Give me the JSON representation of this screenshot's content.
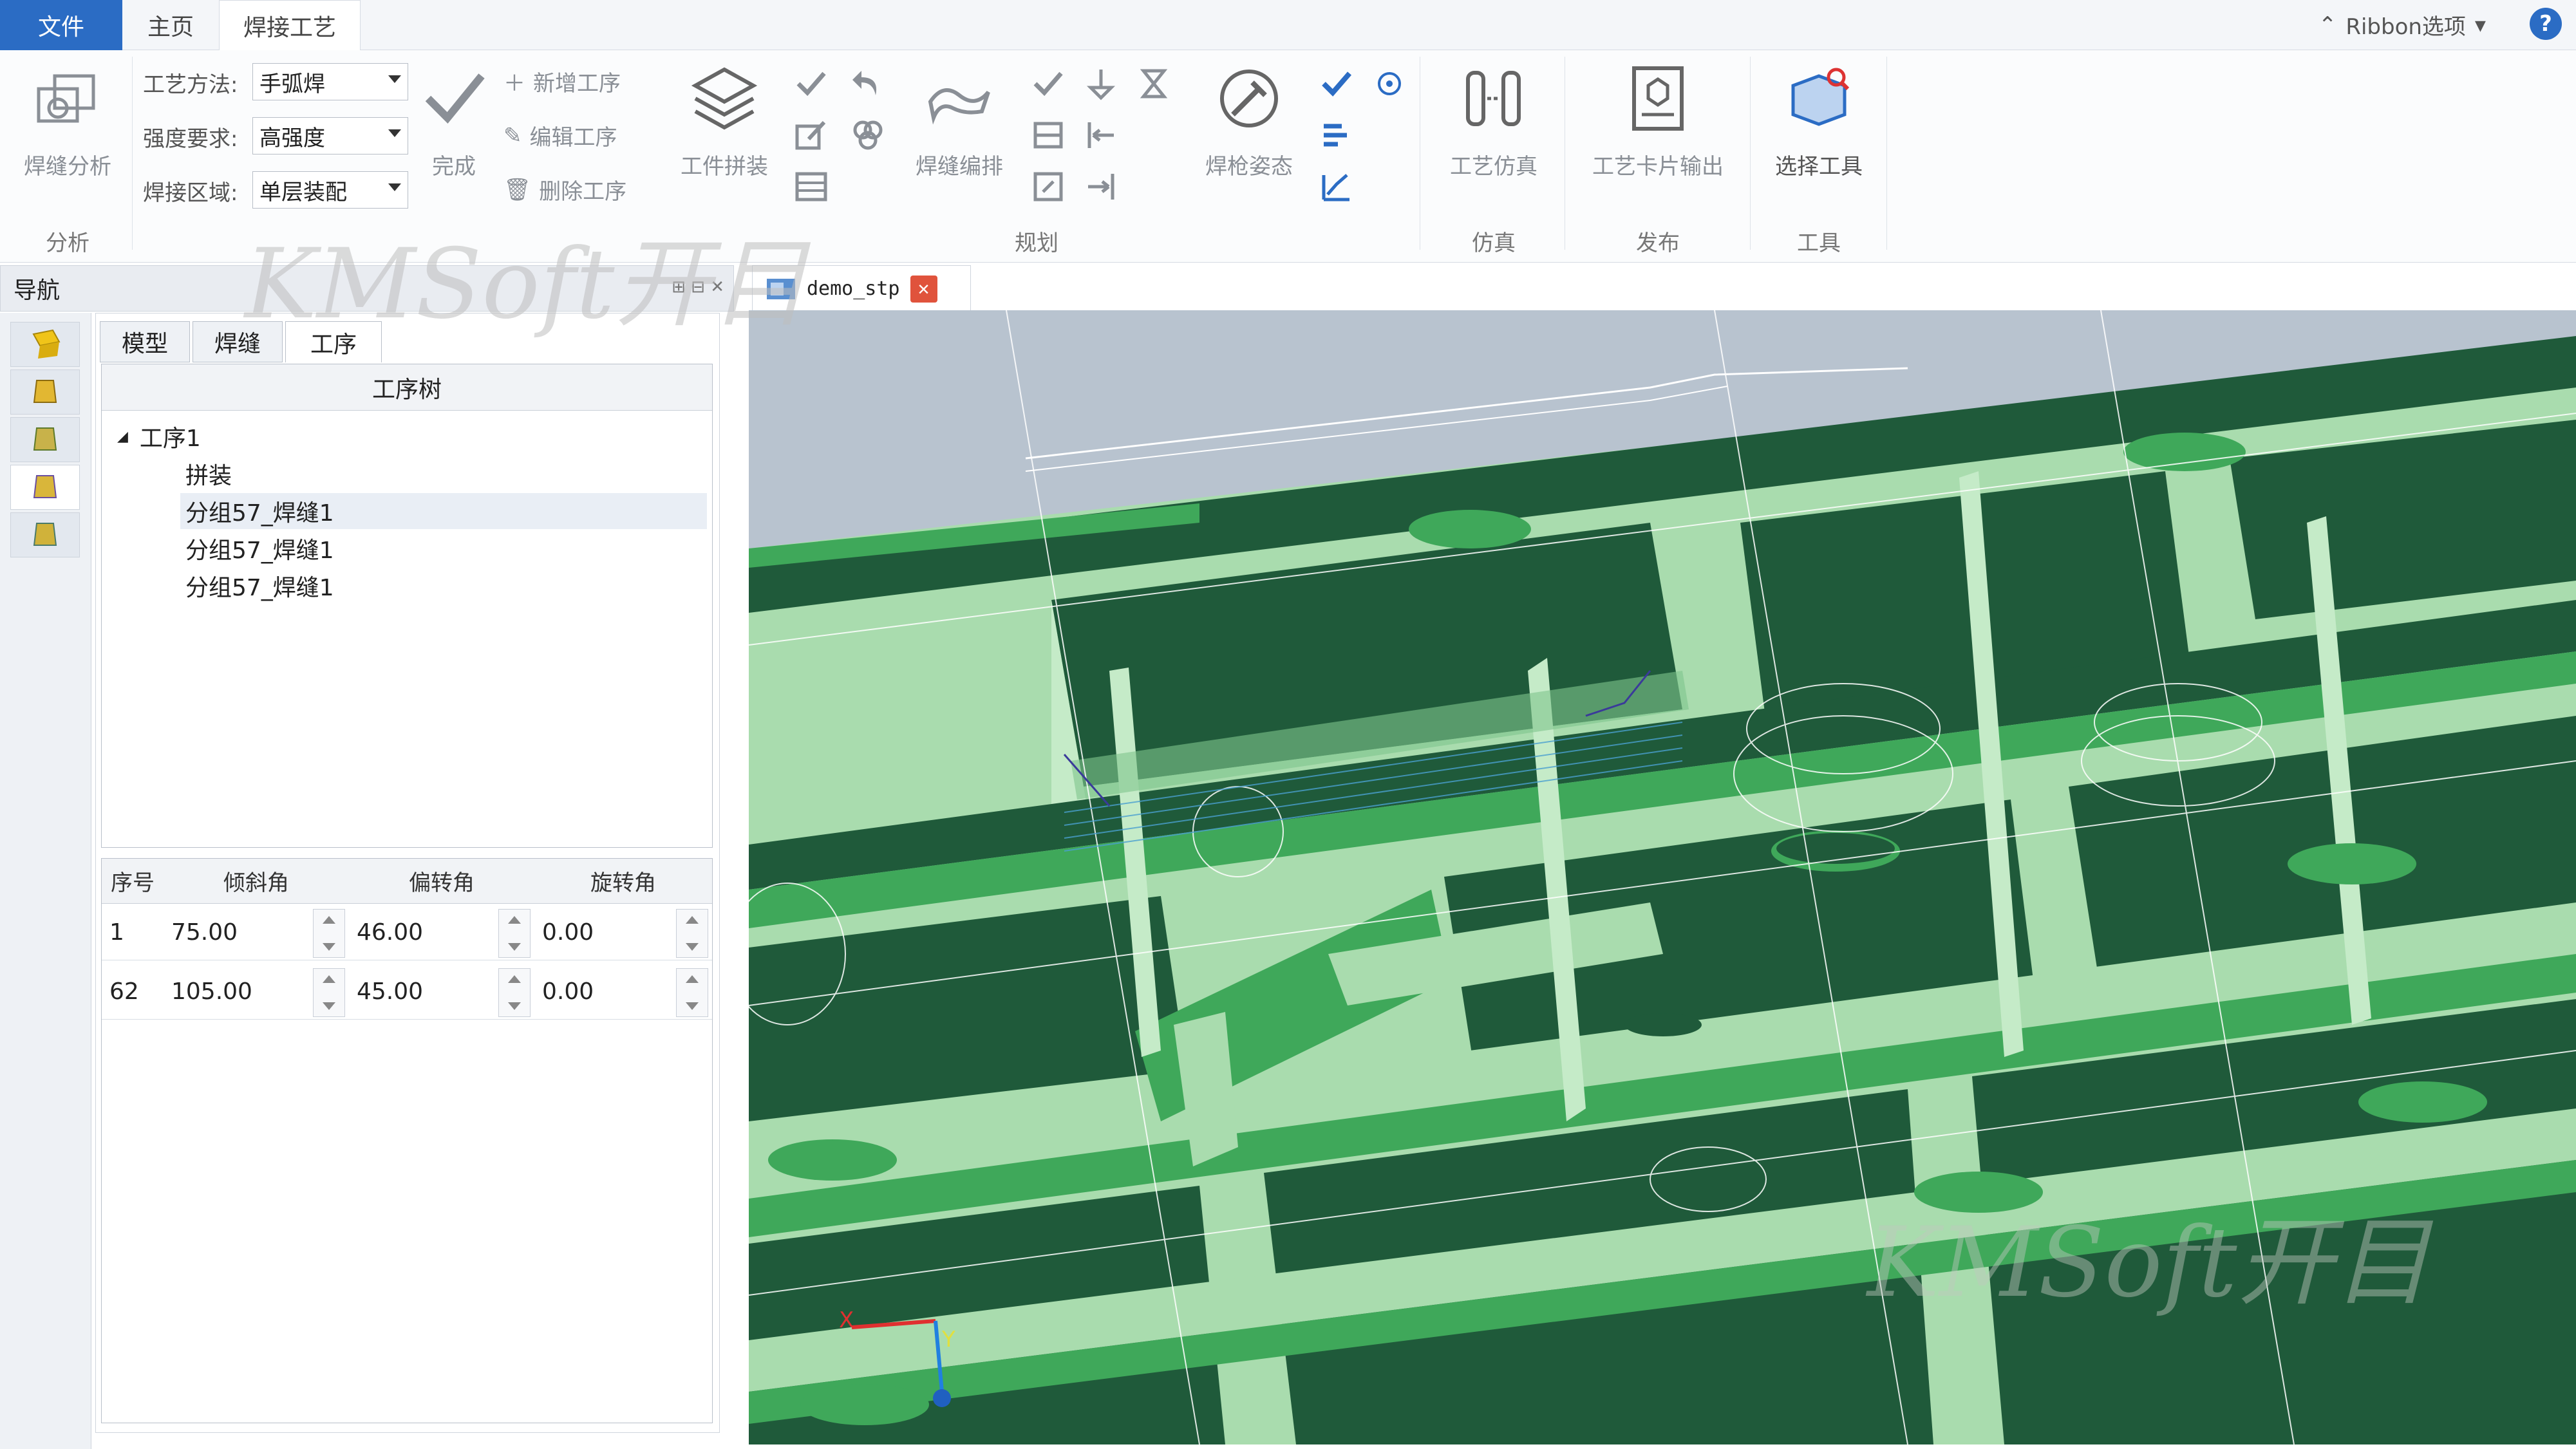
{
  "tabs": {
    "file": "文件",
    "home": "主页",
    "weld": "焊接工艺"
  },
  "ribbon_options": "Ribbon选项",
  "ribbon": {
    "analysis": {
      "weld_analysis": "焊缝分析",
      "group": "分析"
    },
    "params": {
      "method_label": "工艺方法:",
      "method_value": "手弧焊",
      "strength_label": "强度要求:",
      "strength_value": "高强度",
      "area_label": "焊接区域:",
      "area_value": "单层装配"
    },
    "done": "完成",
    "ops": {
      "add": "新增工序",
      "edit": "编辑工序",
      "delete": "删除工序"
    },
    "assembly": "工件拼装",
    "weld_arrange": "焊缝编排",
    "torch_pose": "焊枪姿态",
    "plan_group": "规划",
    "process_sim": "工艺仿真",
    "sim_group": "仿真",
    "card_output": "工艺卡片输出",
    "publish_group": "发布",
    "select_tool": "选择工具",
    "tool_group": "工具"
  },
  "nav": {
    "title": "导航"
  },
  "panel": {
    "tabs": [
      "模型",
      "焊缝",
      "工序"
    ],
    "tree_header": "工序树",
    "tree": {
      "root": "工序1",
      "children": [
        "拼装",
        "分组57_焊缝1",
        "分组57_焊缝1",
        "分组57_焊缝1"
      ]
    },
    "grid": {
      "headers": [
        "序号",
        "倾斜角",
        "偏转角",
        "旋转角"
      ],
      "rows": [
        {
          "id": "1",
          "tilt": "75.00",
          "yaw": "46.00",
          "rot": "0.00"
        },
        {
          "id": "62",
          "tilt": "105.00",
          "yaw": "45.00",
          "rot": "0.00"
        }
      ]
    }
  },
  "document": {
    "tab": "demo_stp"
  },
  "axes": {
    "x": "X",
    "y": "Y"
  },
  "watermark": "KMSoft开目",
  "colors": {
    "accent": "#2b6cc4",
    "model_dark": "#1f5a3a",
    "model_light": "#a9dcae",
    "sky": "#b8c3cf"
  }
}
